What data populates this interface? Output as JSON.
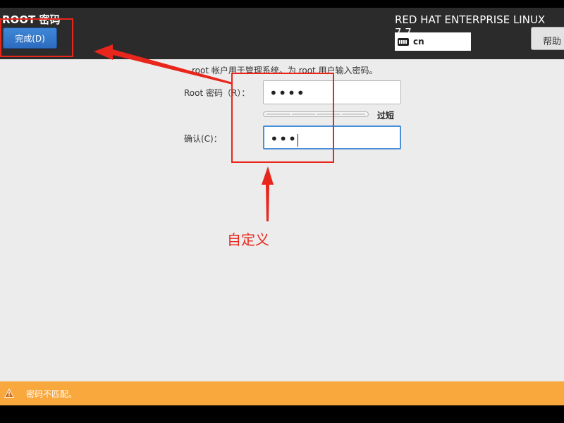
{
  "header": {
    "title": "ROOT 密码",
    "done_label": "完成(D)",
    "product": "RED HAT ENTERPRISE LINUX 7.7",
    "keyboard_lang": "cn",
    "help_label": "帮助"
  },
  "form": {
    "instruction": "root 帐户用于管理系统。为 root 用户输入密码。",
    "password_label": "Root 密码（R）：",
    "password_value": "••••",
    "strength_text": "过短",
    "confirm_label": "确认(C)：",
    "confirm_value": "•••"
  },
  "status": {
    "warning_text": "密码不匹配。"
  },
  "annotation": {
    "text": "自定义",
    "color": "#e8261c"
  },
  "colors": {
    "accent": "#3f87d6",
    "warning": "#f9a83d"
  }
}
